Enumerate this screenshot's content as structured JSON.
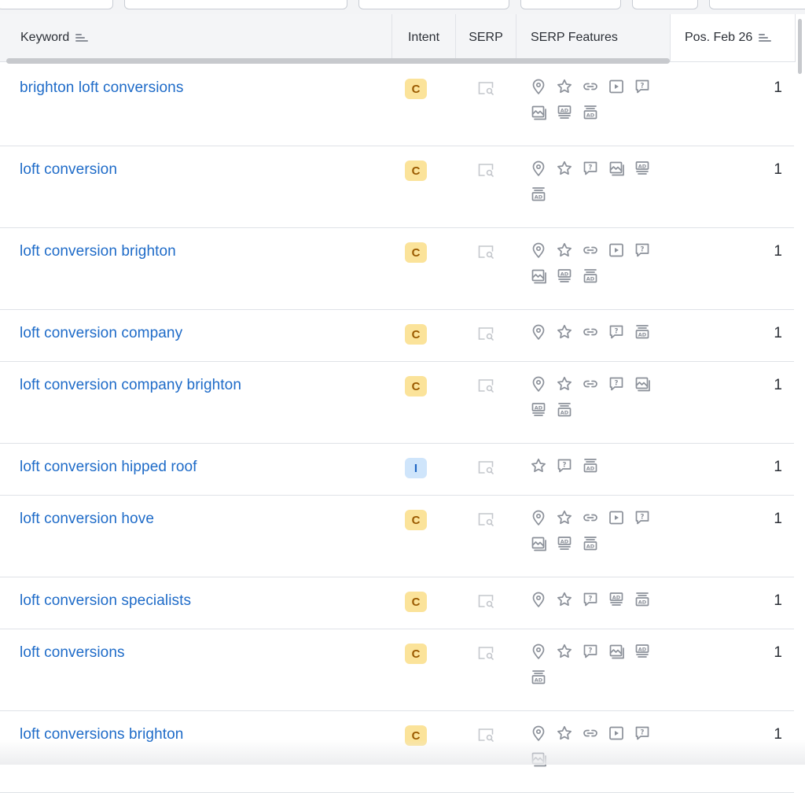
{
  "columns": {
    "keyword": "Keyword",
    "intent": "Intent",
    "serp": "SERP",
    "serp_features": "SERP Features",
    "pos": "Pos. Feb 26"
  },
  "icon_names": {
    "local": "map-pin-icon",
    "reviews": "star-icon",
    "sitelinks": "link-icon",
    "video": "video-play-icon",
    "faq": "question-icon",
    "image": "image-icon",
    "ad-top": "ad-top-icon",
    "ad-bottom": "ad-bottom-icon",
    "serp": "serp-preview-icon",
    "sort": "sort-icon"
  },
  "colors": {
    "link": "#1e6bc8",
    "commercial_badge_bg": "#fbe39a",
    "commercial_badge_text": "#9a5a00",
    "informational_badge_bg": "#cfe5fb",
    "informational_badge_text": "#1f66c4",
    "icon_gray": "#8b9099",
    "serp_icon_gray": "#c4c7cc"
  },
  "rows": [
    {
      "keyword": "brighton loft conversions",
      "intent": "C",
      "features": [
        "local",
        "reviews",
        "sitelinks",
        "video",
        "faq",
        "image",
        "ad-top",
        "ad-bottom"
      ],
      "pos": "1"
    },
    {
      "keyword": "loft conversion",
      "intent": "C",
      "features": [
        "local",
        "reviews",
        "faq",
        "image",
        "ad-top",
        "ad-bottom"
      ],
      "pos": "1"
    },
    {
      "keyword": "loft conversion brighton",
      "intent": "C",
      "features": [
        "local",
        "reviews",
        "sitelinks",
        "video",
        "faq",
        "image",
        "ad-top",
        "ad-bottom"
      ],
      "pos": "1"
    },
    {
      "keyword": "loft conversion company",
      "intent": "C",
      "features": [
        "local",
        "reviews",
        "sitelinks",
        "faq",
        "ad-bottom"
      ],
      "pos": "1"
    },
    {
      "keyword": "loft conversion company brighton",
      "intent": "C",
      "features": [
        "local",
        "reviews",
        "sitelinks",
        "faq",
        "image",
        "ad-top",
        "ad-bottom"
      ],
      "pos": "1"
    },
    {
      "keyword": "loft conversion hipped roof",
      "intent": "I",
      "features": [
        "reviews",
        "faq",
        "ad-bottom"
      ],
      "pos": "1"
    },
    {
      "keyword": "loft conversion hove",
      "intent": "C",
      "features": [
        "local",
        "reviews",
        "sitelinks",
        "video",
        "faq",
        "image",
        "ad-top",
        "ad-bottom"
      ],
      "pos": "1"
    },
    {
      "keyword": "loft conversion specialists",
      "intent": "C",
      "features": [
        "local",
        "reviews",
        "faq",
        "ad-top",
        "ad-bottom"
      ],
      "pos": "1"
    },
    {
      "keyword": "loft conversions",
      "intent": "C",
      "features": [
        "local",
        "reviews",
        "faq",
        "image",
        "ad-top",
        "ad-bottom"
      ],
      "pos": "1"
    },
    {
      "keyword": "loft conversions brighton",
      "intent": "C",
      "features": [
        "local",
        "reviews",
        "sitelinks",
        "video",
        "faq",
        "image"
      ],
      "pos": "1"
    }
  ]
}
